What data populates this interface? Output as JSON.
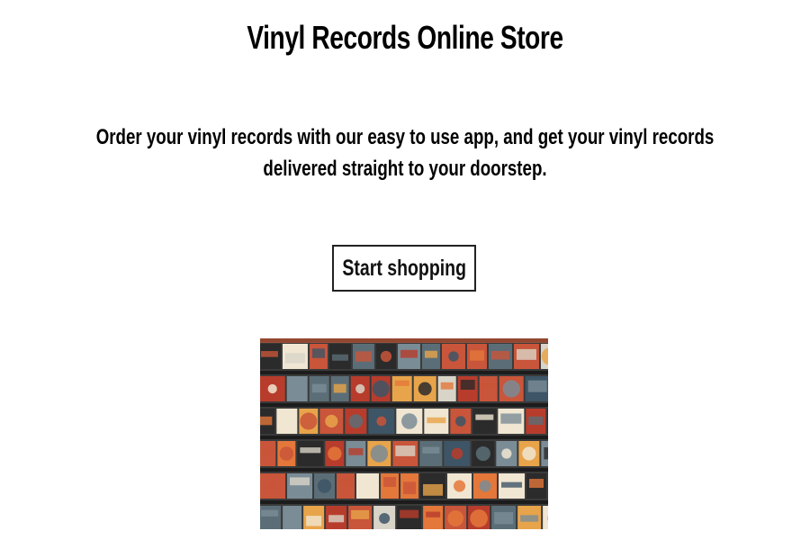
{
  "header": {
    "title": "Vinyl Records Online Store"
  },
  "hero": {
    "tagline_line1": "Order your vinyl records with our easy to use app, and get your vinyl records",
    "tagline_line2": "delivered straight to your doorstep.",
    "cta_label": "Start shopping",
    "image_subject": "record-store-shelves-photo"
  },
  "colors": {
    "text": "#000000",
    "background": "#ffffff",
    "button_border": "#222222",
    "photo_palette": [
      "#e4773a",
      "#2b2b2b",
      "#d9d4c8",
      "#7a8c96",
      "#c9553a",
      "#f0e6d2",
      "#3d5566",
      "#b83c2c",
      "#e8a44a",
      "#5b6e77"
    ]
  }
}
